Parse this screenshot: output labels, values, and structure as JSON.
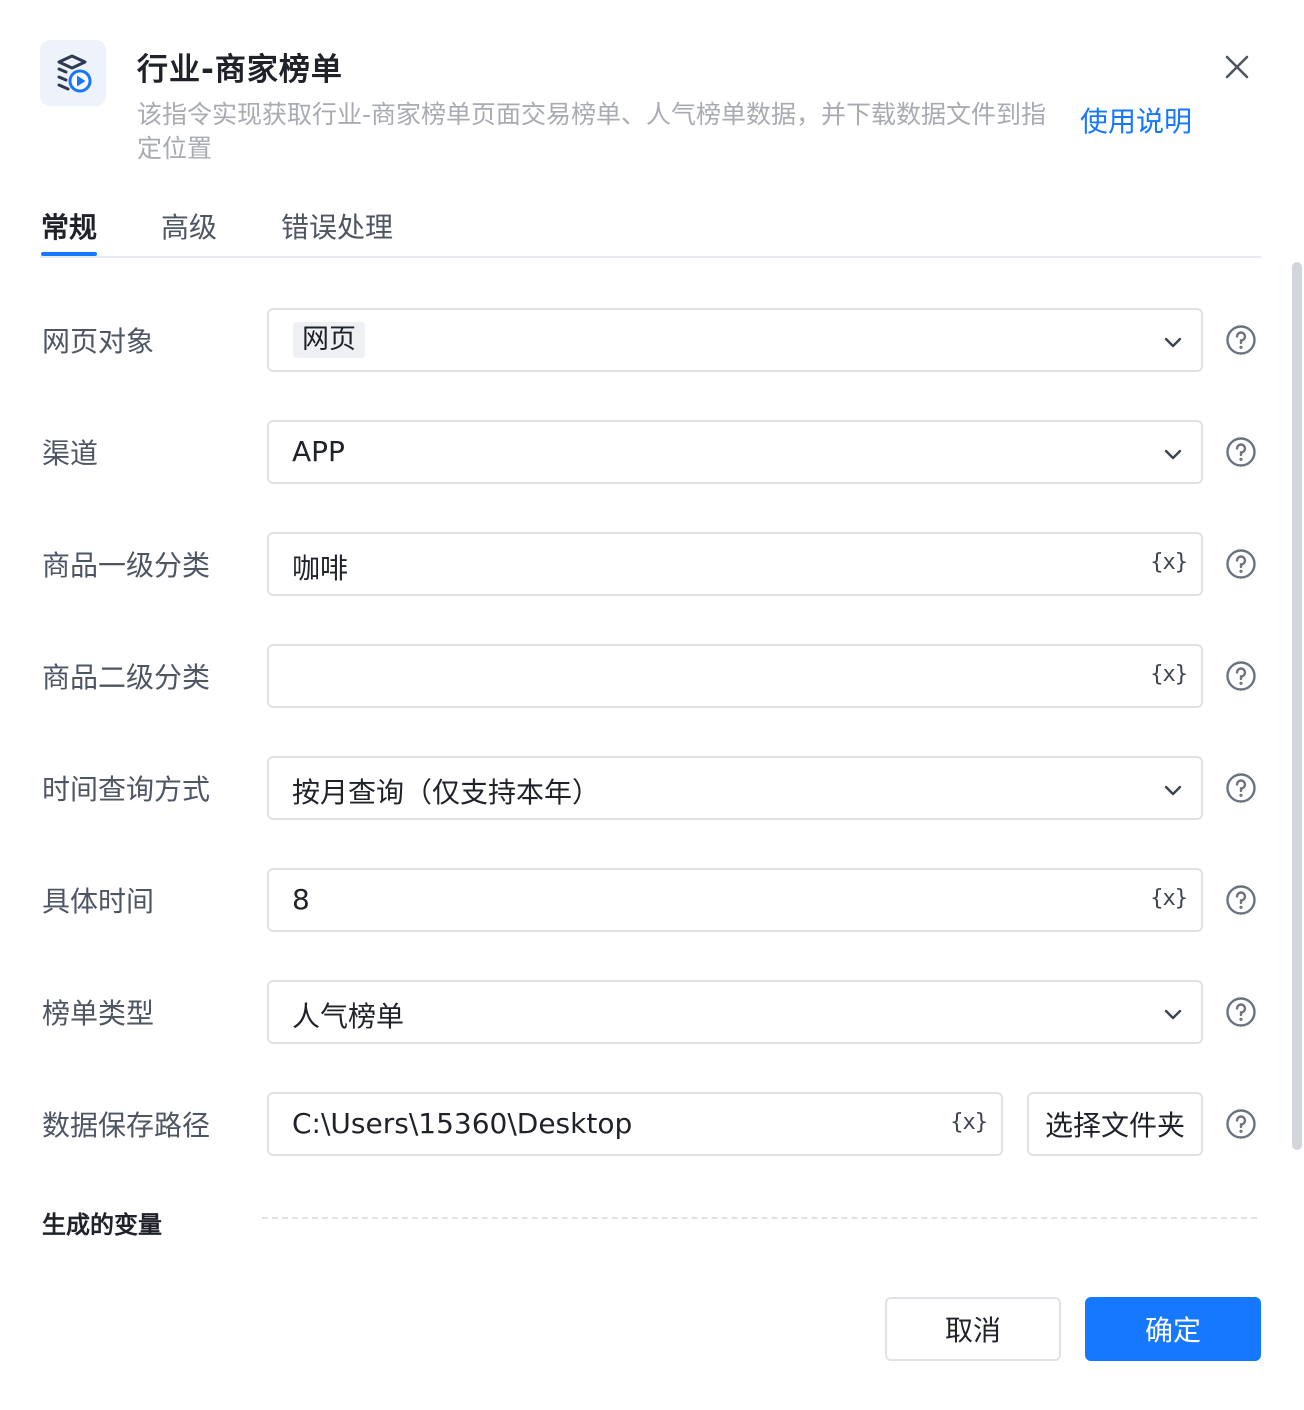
{
  "header": {
    "app_icon": "command-layers-play-icon",
    "title": "行业-商家榜单",
    "description": "该指令实现获取行业-商家榜单页面交易榜单、人气榜单数据，并下载数据文件到指定位置",
    "help_link": "使用说明",
    "close_icon": "close-icon"
  },
  "tabs": [
    {
      "label": "常规",
      "active": true
    },
    {
      "label": "高级",
      "active": false
    },
    {
      "label": "错误处理",
      "active": false
    }
  ],
  "form": {
    "web_object": {
      "label": "网页对象",
      "value": "网页"
    },
    "channel": {
      "label": "渠道",
      "value": "APP"
    },
    "category_l1": {
      "label": "商品一级分类",
      "value": "咖啡"
    },
    "category_l2": {
      "label": "商品二级分类",
      "value": ""
    },
    "time_query_mode": {
      "label": "时间查询方式",
      "value": "按月查询（仅支持本年）"
    },
    "specific_time": {
      "label": "具体时间",
      "value": "8"
    },
    "list_type": {
      "label": "榜单类型",
      "value": "人气榜单"
    },
    "save_path": {
      "label": "数据保存路径",
      "value": "C:\\Users\\15360\\Desktop",
      "folder_button": "选择文件夹"
    },
    "variable_button": "{x}"
  },
  "generated_vars": {
    "label": "生成的变量"
  },
  "footer": {
    "cancel": "取消",
    "confirm": "确定"
  },
  "colors": {
    "primary": "#1677ff",
    "border": "#dfe2e7",
    "muted_text": "#a8abb2"
  }
}
